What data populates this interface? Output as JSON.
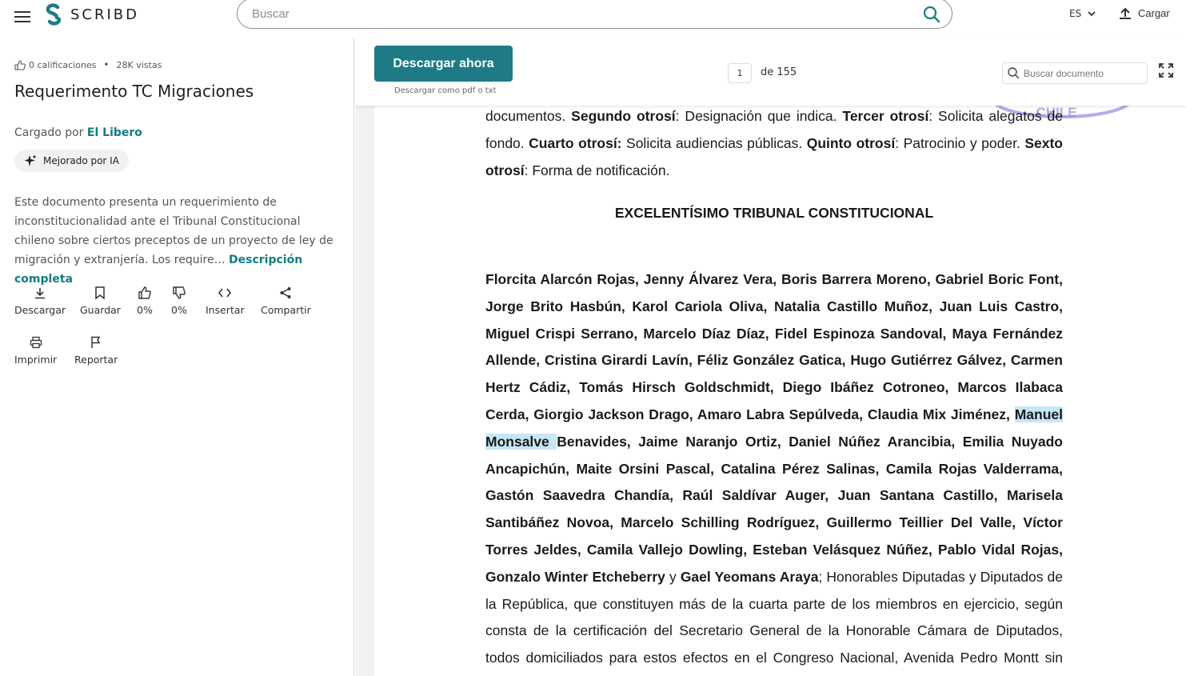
{
  "header": {
    "logo_text": "SCRIBD",
    "search_placeholder": "Buscar",
    "language": "ES",
    "upload_label": "Cargar"
  },
  "sidebar": {
    "ratings": "0 calificaciones",
    "views": "28K vistas",
    "title": "Requerimento TC Migraciones",
    "uploaded_prefix": "Cargado por",
    "uploader": "El Libero",
    "ai_badge": "Mejorado por IA",
    "description": "Este documento presenta un requerimiento de inconstitucionalidad ante el Tribunal Constitucional chileno sobre ciertos preceptos de un proyecto de ley de migración y extranjería. Los require…",
    "description_link": "Descripción completa",
    "actions": [
      {
        "label": "Descargar",
        "icon": "download-icon"
      },
      {
        "label": "Guardar",
        "icon": "bookmark-icon"
      },
      {
        "label": "0%",
        "icon": "thumbs-up-icon"
      },
      {
        "label": "0%",
        "icon": "thumbs-down-icon"
      },
      {
        "label": "Insertar",
        "icon": "code-icon"
      },
      {
        "label": "Compartir",
        "icon": "share-icon"
      },
      {
        "label": "Imprimir",
        "icon": "print-icon"
      },
      {
        "label": "Reportar",
        "icon": "flag-icon"
      }
    ]
  },
  "viewer": {
    "download_button": "Descargar ahora",
    "download_sub": "Descargar como pdf o txt",
    "current_page": "1",
    "page_total": "de 155",
    "search_placeholder": "Buscar documento"
  },
  "document": {
    "stamp_text": "CHILE",
    "heading": "EXCELENTÍSIMO TRIBUNAL CONSTITUCIONAL",
    "p1": [
      {
        "t": "documentos. ",
        "b": false
      },
      {
        "t": "Segundo otrosí",
        "b": true
      },
      {
        "t": ": Designación que indica. ",
        "b": false
      },
      {
        "t": "Tercer otrosí",
        "b": true
      },
      {
        "t": ": Solicita alegatos de fondo. ",
        "b": false
      },
      {
        "t": "Cuarto otrosí:",
        "b": true
      },
      {
        "t": " Solicita audiencias públicas. ",
        "b": false
      },
      {
        "t": "Quinto otrosí",
        "b": true
      },
      {
        "t": ": Patrocinio y poder. ",
        "b": false
      },
      {
        "t": "Sexto otrosí",
        "b": true
      },
      {
        "t": ": Forma de notificación.",
        "b": false
      }
    ],
    "p2_before": "Florcita Alarcón Rojas, Jenny Álvarez Vera, Boris Barrera Moreno, Gabriel Boric Font, Jorge Brito Hasbún, Karol Cariola Oliva, Natalia Castillo Muñoz, Juan Luis Castro, Miguel Crispi Serrano, Marcelo Díaz Díaz, Fidel Espinoza Sandoval, Maya Fernández Allende, Cristina Girardi Lavín, Féliz González Gatica, Hugo Gutiérrez Gálvez, Carmen Hertz Cádiz, Tomás Hirsch Goldschmidt, Diego Ibáñez Cotroneo, Marcos Ilabaca Cerda, Giorgio Jackson Drago, Amaro Labra Sepúlveda, Claudia Mix Jiménez, ",
    "p2_highlight": "Manuel Monsalve ",
    "p2_after": "Benavides, Jaime Naranjo Ortiz, Daniel Núñez Arancibia, Emilia Nuyado Ancapichún, Maite Orsini Pascal, Catalina Pérez Salinas, Camila Rojas Valderrama, Gastón Saavedra Chandía, Raúl Saldívar Auger, Juan Santana Castillo, Marisela Santibáñez Novoa, Marcelo Schilling Rodríguez, Guillermo Teillier Del Valle, Víctor Torres Jeldes, Camila Vallejo Dowling, Esteban Velásquez Núñez, Pablo Vidal Rojas, Gonzalo Winter Etcheberry",
    "p2_and": " y ",
    "p2_last_name": "Gael Yeomans Araya",
    "p2_rest": "; Honorables Diputadas y Diputados de la República, que constituyen más de la cuarta parte de los miembros en ejercicio, según consta de la certificación del Secretario General de la Honorable Cámara de Diputados, todos domiciliados para estos efectos en el Congreso Nacional, Avenida Pedro Montt sin número, comuna y ciudad de Valparaíso, a S.S. Excma. respetuosamente decimos:"
  }
}
